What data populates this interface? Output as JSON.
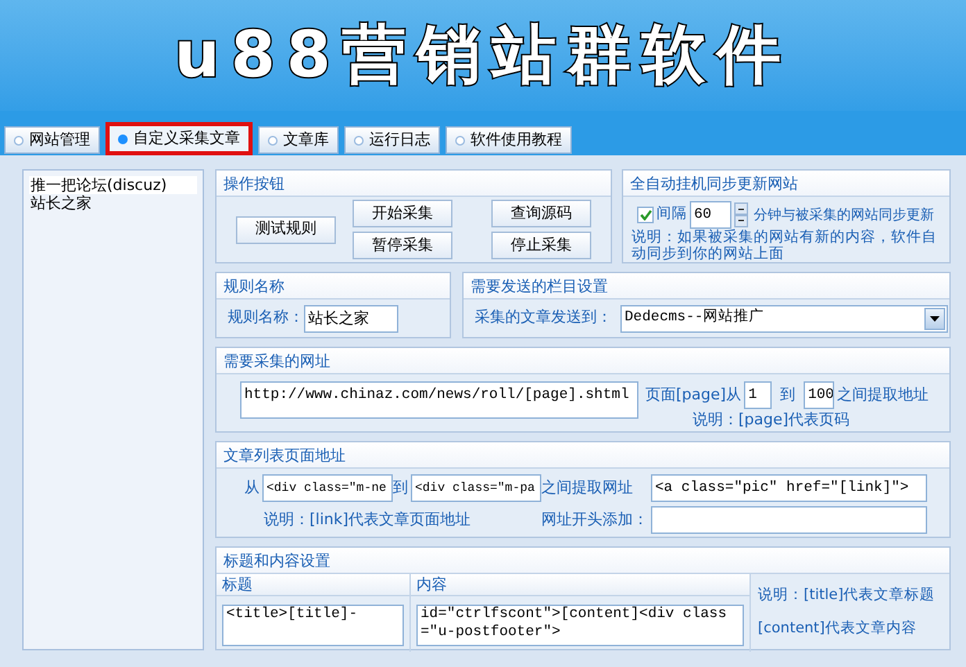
{
  "header": {
    "title": "u88营销站群软件"
  },
  "tabs": [
    {
      "label": "网站管理",
      "selected": false
    },
    {
      "label": "自定义采集文章",
      "selected": true
    },
    {
      "label": "文章库",
      "selected": false
    },
    {
      "label": "运行日志",
      "selected": false
    },
    {
      "label": "软件使用教程",
      "selected": false
    }
  ],
  "rule_list": {
    "items": [
      {
        "label": "推一把论坛(discuz)",
        "selected": true
      },
      {
        "label": "站长之家",
        "selected": false
      }
    ]
  },
  "operation_buttons": {
    "title": "操作按钮",
    "buttons": [
      "测试规则",
      "开始采集",
      "暂停采集",
      "查询源码",
      "停止采集"
    ]
  },
  "auto_sync": {
    "title": "全自动挂机同步更新网站",
    "checkbox": {
      "label": "间隔",
      "checked": true
    },
    "interval": "60",
    "unit_label": "分钟与被采集的网站同步更新",
    "note": "说明：如果被采集的网站有新的内容，软件自动同步到你的网站上面"
  },
  "rule_name": {
    "title": "规则名称",
    "label": "规则名称：",
    "value": "站长之家"
  },
  "category": {
    "title": "需要发送的栏目设置",
    "label": "采集的文章发送到：",
    "value": "Dedecms--网站推广"
  },
  "source_url": {
    "title": "需要采集的网址",
    "value": "http://www.chinaz.com/news/roll/[page].shtml",
    "page_from_label": "页面[page]从",
    "from": "1",
    "to_label": "到",
    "to": "100",
    "range_label": "之间提取地址",
    "note": "说明：[page]代表页码"
  },
  "list_page": {
    "title": "文章列表页面地址",
    "from_label": "从",
    "from": "<div class=\"m-ne",
    "to_label": "到",
    "to": "<div class=\"m-pa",
    "range_label": "之间提取网址",
    "link_pattern": "<a class=\"pic\" href=\"[link]\">",
    "note": "说明：[link]代表文章页面地址",
    "prefix_label": "网址开头添加："
  },
  "title_content": {
    "title": "标题和内容设置",
    "title_column": {
      "heading": "标题",
      "value": "<title>[title]-"
    },
    "content_column": {
      "heading": "内容",
      "value": "id=\"ctrlfscont\">[content]<div class=\"u-postfooter\">"
    },
    "notes": [
      "说明：[title]代表文章标题",
      "[content]代表文章内容"
    ]
  }
}
